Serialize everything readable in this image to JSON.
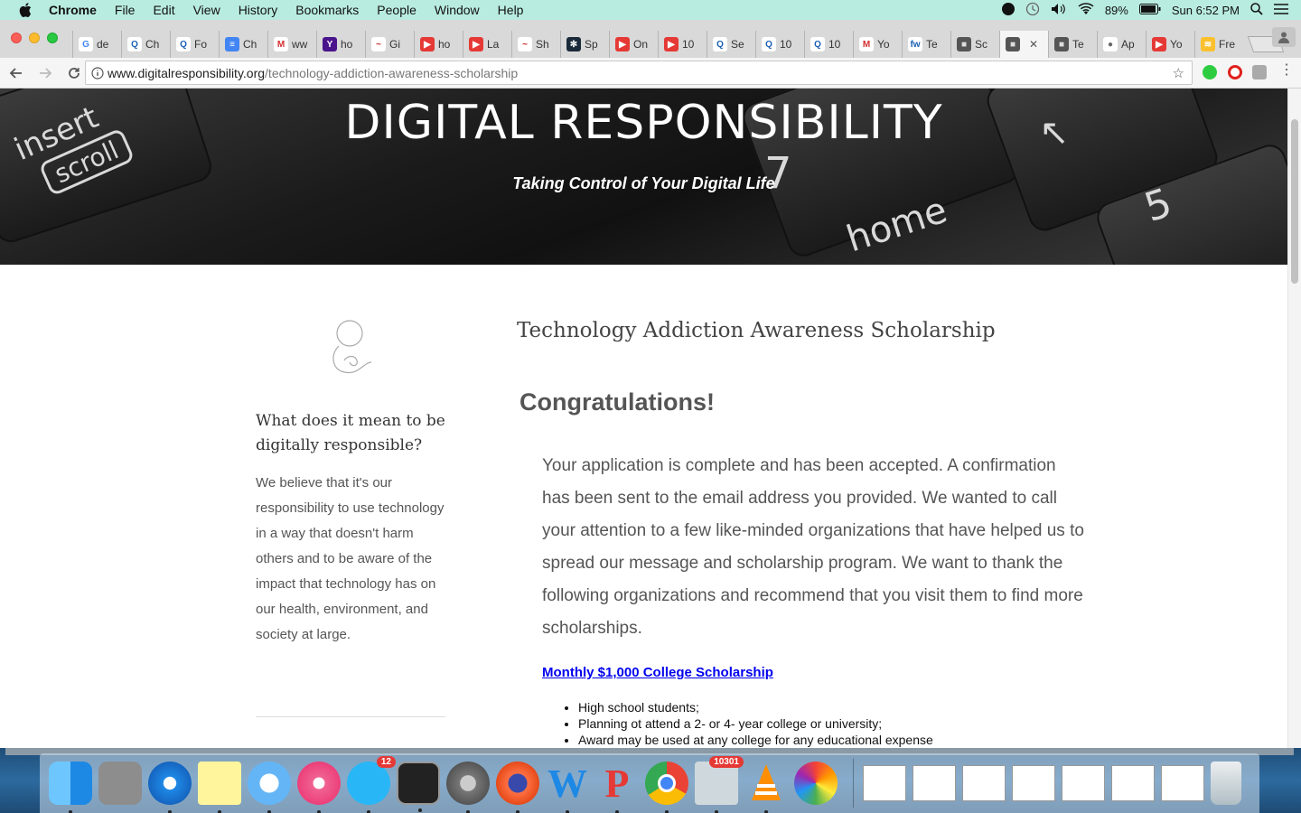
{
  "menubar": {
    "app_name": "Chrome",
    "menus": [
      "File",
      "Edit",
      "View",
      "History",
      "Bookmarks",
      "People",
      "Window",
      "Help"
    ],
    "battery": "89%",
    "clock": "Sun 6:52 PM"
  },
  "tabs": [
    {
      "label": "de",
      "fav_color": "#ffffff",
      "fav_text": "G",
      "fav_fg": "#4285f4"
    },
    {
      "label": "Ch",
      "fav_color": "#ffffff",
      "fav_text": "Q",
      "fav_fg": "#1a5fb4"
    },
    {
      "label": "Fo",
      "fav_color": "#ffffff",
      "fav_text": "Q",
      "fav_fg": "#1a5fb4"
    },
    {
      "label": "Ch",
      "fav_color": "#4285f4",
      "fav_text": "≡",
      "fav_fg": "#ffffff"
    },
    {
      "label": "ww",
      "fav_color": "#ffffff",
      "fav_text": "M",
      "fav_fg": "#d32f2f"
    },
    {
      "label": "ho",
      "fav_color": "#4a148c",
      "fav_text": "Y",
      "fav_fg": "#ffffff"
    },
    {
      "label": "Gi",
      "fav_color": "#ffffff",
      "fav_text": "~",
      "fav_fg": "#c62828"
    },
    {
      "label": "ho",
      "fav_color": "#e53935",
      "fav_text": "▶",
      "fav_fg": "#ffffff"
    },
    {
      "label": "La",
      "fav_color": "#e53935",
      "fav_text": "▶",
      "fav_fg": "#ffffff"
    },
    {
      "label": "Sh",
      "fav_color": "#ffffff",
      "fav_text": "~",
      "fav_fg": "#c62828"
    },
    {
      "label": "Sp",
      "fav_color": "#1b2a3a",
      "fav_text": "✻",
      "fav_fg": "#ffffff"
    },
    {
      "label": "On",
      "fav_color": "#e53935",
      "fav_text": "▶",
      "fav_fg": "#ffffff"
    },
    {
      "label": "10",
      "fav_color": "#e53935",
      "fav_text": "▶",
      "fav_fg": "#ffffff"
    },
    {
      "label": "Se",
      "fav_color": "#ffffff",
      "fav_text": "Q",
      "fav_fg": "#1a5fb4"
    },
    {
      "label": "10",
      "fav_color": "#ffffff",
      "fav_text": "Q",
      "fav_fg": "#1a5fb4"
    },
    {
      "label": "10",
      "fav_color": "#ffffff",
      "fav_text": "Q",
      "fav_fg": "#1a5fb4"
    },
    {
      "label": "Yo",
      "fav_color": "#ffffff",
      "fav_text": "M",
      "fav_fg": "#d32f2f"
    },
    {
      "label": "Te",
      "fav_color": "#ffffff",
      "fav_text": "fw",
      "fav_fg": "#1a5fb4"
    },
    {
      "label": "Sc",
      "fav_color": "#555555",
      "fav_text": "■",
      "fav_fg": "#dddddd"
    },
    {
      "label": "",
      "fav_color": "#555555",
      "fav_text": "■",
      "fav_fg": "#dddddd",
      "active": true
    },
    {
      "label": "Te",
      "fav_color": "#555555",
      "fav_text": "■",
      "fav_fg": "#dddddd"
    },
    {
      "label": "Ap",
      "fav_color": "#ffffff",
      "fav_text": "●",
      "fav_fg": "#666666"
    },
    {
      "label": "Yo",
      "fav_color": "#e53935",
      "fav_text": "▶",
      "fav_fg": "#ffffff"
    },
    {
      "label": "Fre",
      "fav_color": "#fbc02d",
      "fav_text": "≋",
      "fav_fg": "#ffffff"
    }
  ],
  "address": {
    "host": "www.digitalresponsibility.org",
    "path": "/technology-addiction-awareness-scholarship"
  },
  "hero": {
    "title": "DIGITAL RESPONSIBILITY",
    "subtitle": "Taking Control of Your Digital Life",
    "key_insert": "insert",
    "key_scroll": "scroll",
    "key_seven": "7",
    "key_home": "home",
    "key_five": "5"
  },
  "sidebar": {
    "heading": "What does it mean to be digitally responsible?",
    "text": "We believe that it's our responsibility to use technology in a way that doesn't harm others and to be aware of the impact that technology has on our health, environment, and society at large."
  },
  "main": {
    "title": "Technology Addiction Awareness Scholarship",
    "congrats": "Congratulations!",
    "paragraph": "Your application is complete and has been accepted. A confirmation has been sent to the email address you provided. We wanted to call your attention to a few like-minded organizations that have helped us to spread our message and scholarship program. We want to thank the following organizations and recommend that you visit them to find more scholarships.",
    "link1": "Monthly $1,000 College Scholarship",
    "list1": [
      "High school students;",
      "Planning ot attend a 2- or 4- year college or university;",
      "Award may be used at any college for any educational expense"
    ]
  },
  "dock": {
    "app_store_badge": "12",
    "mail_badge": "10301"
  }
}
